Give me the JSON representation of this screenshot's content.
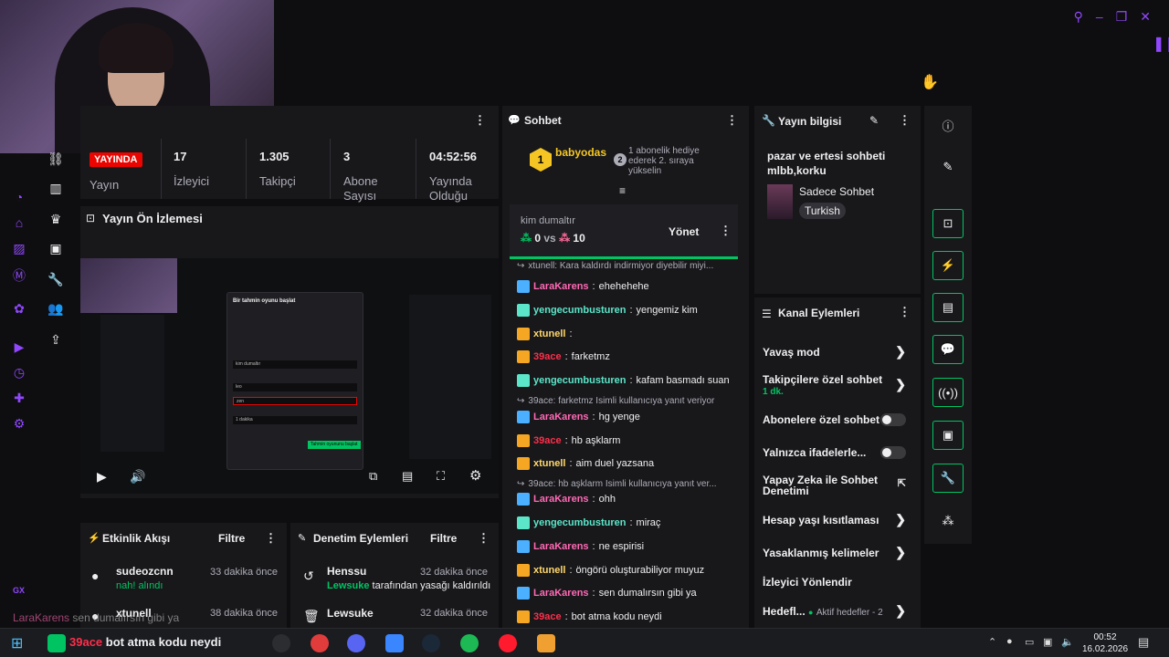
{
  "stats": {
    "live_label": "YAYINDA",
    "live_sub": "Yayın",
    "viewers": "17",
    "viewers_label": "İzleyici",
    "followers": "1.305",
    "followers_label": "Takipçi",
    "subs": "3",
    "subs_label": "Abone Sayısı",
    "uptime": "04:52:56",
    "uptime_label": "Yayında Olduğu"
  },
  "preview": {
    "title": "Yayın Ön İzlemesi",
    "dialog_title": "Bir tahmin oyunu başlat",
    "dialog_field_value": "kim dumaltır",
    "dialog_option1": "leo",
    "dialog_option2": "zen",
    "dialog_duration": "1 dakika",
    "dialog_submit": "Tahmin oyununu başlat"
  },
  "activity": {
    "title": "Etkinlik Akışı",
    "filter": "Filtre",
    "items": [
      {
        "name": "sudeozcnn",
        "time": "33 dakika önce",
        "sub": "nah! alındı"
      },
      {
        "name": "xtunell",
        "time": "38 dakika önce",
        "sub": ""
      }
    ]
  },
  "mod": {
    "title": "Denetim Eylemleri",
    "filter": "Filtre",
    "items": [
      {
        "name": "Henssu",
        "time": "32 dakika önce",
        "actor": "Lewsuke",
        "sub": "tarafından yasağı kaldırıldı"
      },
      {
        "name": "Lewsuke",
        "time": "32 dakika önce",
        "sub": ""
      }
    ]
  },
  "chat": {
    "title": "Sohbet",
    "gift_user": "babyodas",
    "gift_count": "1",
    "gift_rank": "2",
    "gift_text": "1 abonelik hediye ederek 2. sıraya yükselin",
    "prediction": {
      "question": "kim dumaltır",
      "left": "0",
      "vs": "vs",
      "right": "10",
      "manage": "Yönet"
    },
    "messages": [
      {
        "type": "sys",
        "text": "xtunell: Kara kaldırdı indirmiyor diyebilir miyi..."
      },
      {
        "user": "LaraKarens",
        "text": "ehehehehe",
        "color": "#ff69b4",
        "badge": "#4ab0ff"
      },
      {
        "user": "yengecumbusturen",
        "text": "yengemiz kim",
        "color": "#5be6c9",
        "badge": "#5be6c9"
      },
      {
        "user": "xtunell",
        "text": "",
        "color": "#ffd76a",
        "badge": "#f5a623"
      },
      {
        "user": "39ace",
        "text": "farketmz",
        "color": "#ff2e4a",
        "badge": "#f5a623"
      },
      {
        "user": "yengecumbusturen",
        "text": "kafam basmadı suan",
        "color": "#5be6c9",
        "badge": "#5be6c9"
      },
      {
        "type": "sys",
        "text": "39ace: farketmz İsimli kullanıcıya yanıt veriyor"
      },
      {
        "user": "LaraKarens",
        "text": "hg yenge",
        "color": "#ff69b4",
        "badge": "#4ab0ff"
      },
      {
        "user": "39ace",
        "text": "hb aşklarm",
        "color": "#ff2e4a",
        "badge": "#f5a623"
      },
      {
        "user": "xtunell",
        "text": "aim duel yazsana",
        "color": "#ffd76a",
        "badge": "#f5a623"
      },
      {
        "type": "sys",
        "text": "39ace: hb aşklarm İsimli kullanıcıya yanıt ver..."
      },
      {
        "user": "LaraKarens",
        "text": "ohh",
        "color": "#ff69b4",
        "badge": "#4ab0ff"
      },
      {
        "user": "yengecumbusturen",
        "text": "miraç",
        "color": "#5be6c9",
        "badge": "#5be6c9"
      },
      {
        "user": "LaraKarens",
        "text": "ne espirisi",
        "color": "#ff69b4",
        "badge": "#4ab0ff"
      },
      {
        "user": "xtunell",
        "text": "öngörü oluşturabiliyor muyuz",
        "color": "#ffd76a",
        "badge": "#f5a623"
      },
      {
        "user": "LaraKarens",
        "text": "sen dumalırsın gibi ya",
        "color": "#ff69b4",
        "badge": "#4ab0ff"
      },
      {
        "user": "39ace",
        "text": "bot atma kodu neydi",
        "color": "#ff2e4a",
        "badge": "#f5a623"
      }
    ]
  },
  "info": {
    "title": "Yayın bilgisi",
    "stream_title": "pazar ve ertesi sohbeti mlbb,korku",
    "category": "Sadece Sohbet",
    "language": "Turkish"
  },
  "channel": {
    "title": "Kanal Eylemleri",
    "slow": "Yavaş mod",
    "followers_only": "Takipçilere özel sohbet",
    "followers_only_sub": "1 dk.",
    "subs_only": "Abonelere özel sohbet",
    "emotes_only": "Yalnızca ifadelerle...",
    "ai_mod": "Yapay Zeka ile Sohbet Denetimi",
    "age": "Hesap yaşı kısıtlaması",
    "banned_words": "Yasaklanmış kelimeler",
    "redirect": "İzleyici Yönlendir",
    "goals": "Hedefl...",
    "goals_sub": "Aktif hedefler - 2"
  },
  "overlay": {
    "gx": "GX",
    "bottom_user": "LaraKarens",
    "bottom_text": "sen dumalırsın gibi ya",
    "ticker_user": "39ace",
    "ticker_text": "bot atma kodu neydi"
  },
  "taskbar": {
    "time": "00:52",
    "date": "16.02.2026"
  }
}
